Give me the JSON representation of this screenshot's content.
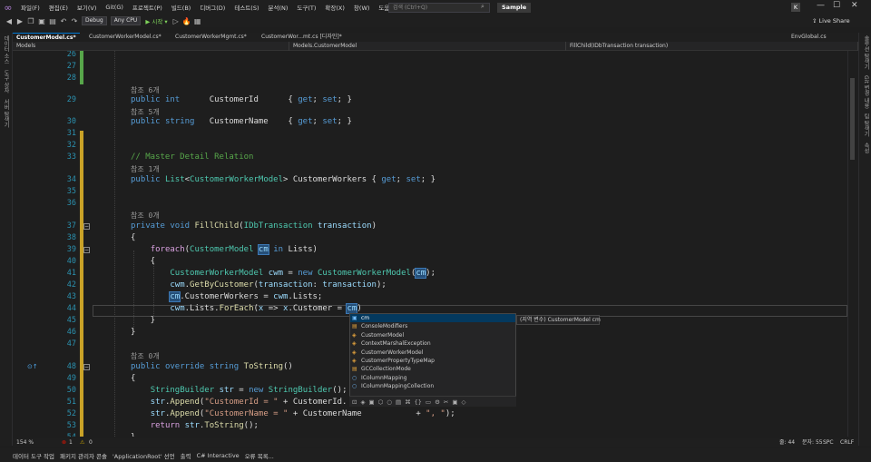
{
  "menu": [
    "파일(F)",
    "편집(E)",
    "보기(V)",
    "Git(G)",
    "프로젝트(P)",
    "빌드(B)",
    "디버그(D)",
    "테스트(S)",
    "분석(N)",
    "도구(T)",
    "확장(X)",
    "창(W)",
    "도움말(H)"
  ],
  "search": {
    "placeholder": "검색 (Ctrl+Q)"
  },
  "solution_name": "Sample",
  "avatar_initial": "K",
  "toolbar": {
    "config": "Debug",
    "platform": "Any CPU",
    "start_label": "▶ 시작 ▾",
    "live_share": "Live Share"
  },
  "left_rail": [
    "데이터 소스",
    "도구 상자",
    "서버 탐색기"
  ],
  "right_rail": [
    "솔루션 탐색기",
    "Git 변경 내용",
    "팀 탐색기",
    "속성"
  ],
  "tabs": [
    "CustomerModel.cs*",
    "CustomerWorkerModel.cs*",
    "CustomerWorkerMgmt.cs*",
    "CustomerWor...mt.cs [디자인]*"
  ],
  "env_tab": "EnvGlobal.cs",
  "nav": {
    "project": "Models",
    "class": "Models.CustomerModel",
    "member": "FillChild(IDbTransaction transaction)"
  },
  "lines": [
    {
      "n": "26",
      "lens": ""
    },
    {
      "n": "27",
      "lens": ""
    },
    {
      "n": "28",
      "lens": ""
    },
    {
      "n": "29",
      "lens": "참조 6개"
    },
    {
      "n": "30",
      "lens": "참조 5개"
    },
    {
      "n": "31",
      "lens": ""
    },
    {
      "n": "32",
      "lens": ""
    },
    {
      "n": "33",
      "lens": ""
    },
    {
      "n": "34",
      "lens": "참조 1개"
    },
    {
      "n": "35",
      "lens": ""
    },
    {
      "n": "36",
      "lens": ""
    },
    {
      "n": "37",
      "lens": "참조 0개"
    },
    {
      "n": "38",
      "lens": ""
    },
    {
      "n": "39",
      "lens": ""
    },
    {
      "n": "40",
      "lens": ""
    },
    {
      "n": "41",
      "lens": ""
    },
    {
      "n": "42",
      "lens": ""
    },
    {
      "n": "43",
      "lens": ""
    },
    {
      "n": "44",
      "lens": ""
    },
    {
      "n": "45",
      "lens": ""
    },
    {
      "n": "46",
      "lens": ""
    },
    {
      "n": "47",
      "lens": ""
    },
    {
      "n": "48",
      "lens": "참조 0개"
    },
    {
      "n": "49",
      "lens": ""
    },
    {
      "n": "50",
      "lens": ""
    },
    {
      "n": "51",
      "lens": ""
    },
    {
      "n": "52",
      "lens": ""
    },
    {
      "n": "53",
      "lens": ""
    },
    {
      "n": "54",
      "lens": ""
    }
  ],
  "code": {
    "l29": "public int      CustomerId      { get; set; }",
    "l30": "public string   CustomerName    { get; set; }",
    "l33": "// Master Detail Relation",
    "l34": "public List<CustomerWorkerModel> CustomerWorkers { get; set; }",
    "l37": "private void FillChild(IDbTransaction transaction)",
    "l38": "{",
    "l39": "    foreach(CustomerModel cm in Lists)",
    "l40": "    {",
    "l41": "        CustomerWorkerModel cwm = new CustomerWorkerModel(cm);",
    "l42": "        cwm.GetByCustomer(transaction: transaction);",
    "l43": "        cm.CustomerWorkers = cwm.Lists;",
    "l44": "        cwm.Lists.ForEach(x => x.Customer = cm)",
    "l45": "    }",
    "l46": "}",
    "l48": "public override string ToString()",
    "l49": "{",
    "l50": "    StringBuilder str = new StringBuilder();",
    "l51": "    str.Append(\"CustomerId = \" + CustomerId.",
    "l52": "    str.Append(\"CustomerName = \" + CustomerName           + \", \");",
    "l53": "    return str.ToString();",
    "l54": "}"
  },
  "autocomplete": {
    "items": [
      "cm",
      "ConsoleModifiers",
      "CustomerModel",
      "ContextMarshalException",
      "CustomerWorkerModel",
      "CustomerPropertyTypeMap",
      "GCCollectionMode",
      "IColumnMapping",
      "IColumnMappingCollection"
    ],
    "tooltip": "(지역 변수) CustomerModel cm"
  },
  "status": {
    "zoom": "154 %",
    "errors": "1",
    "warnings": "0",
    "line": "줄: 44",
    "col": "문자: 55",
    "spc": "SPC",
    "crlf": "CRLF"
  },
  "bottom_tabs": [
    "데이터 도구 작업",
    "패키지 관리자 콘솔",
    "'ApplicationRoot' 선언",
    "출력",
    "C# Interactive",
    "오류 목록..."
  ]
}
